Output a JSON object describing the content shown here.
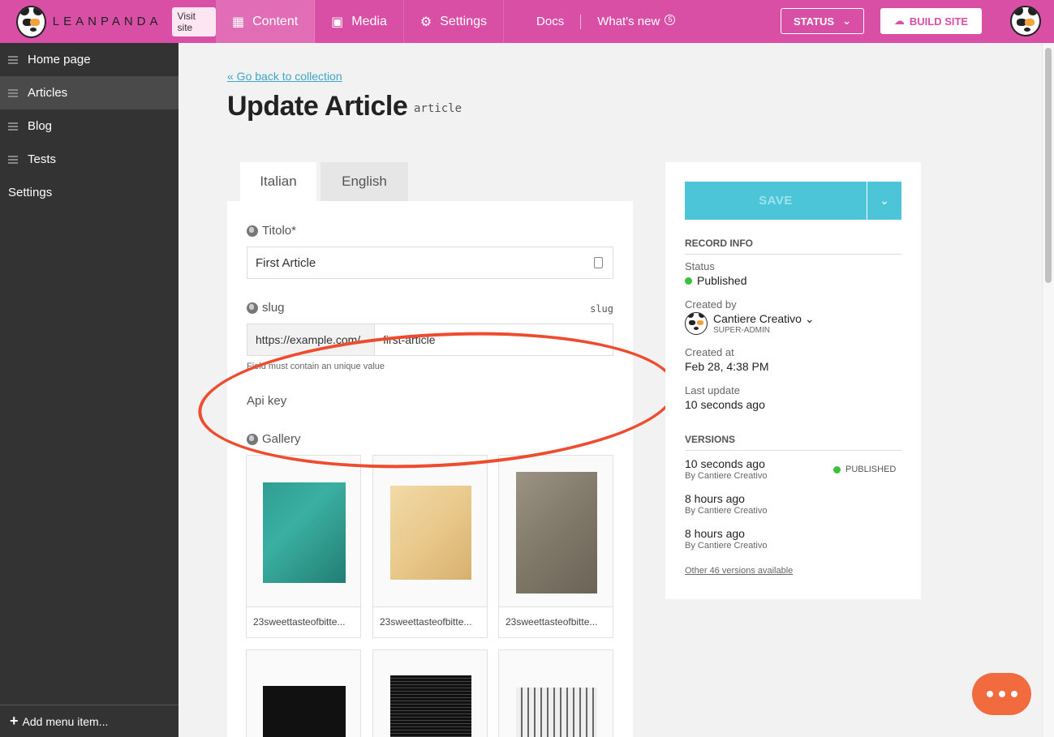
{
  "brand": {
    "wordmark": "LEANPANDA",
    "visit_label": "Visit site"
  },
  "nav": {
    "content": "Content",
    "media": "Media",
    "settings": "Settings",
    "docs": "Docs",
    "whats_new": "What's new",
    "whats_new_badge": "5",
    "status": "STATUS",
    "build": "BUILD SITE"
  },
  "sidebar": {
    "items": [
      {
        "label": "Home page"
      },
      {
        "label": "Articles"
      },
      {
        "label": "Blog"
      },
      {
        "label": "Tests"
      }
    ],
    "settings_label": "Settings",
    "add_label": "Add menu item..."
  },
  "page": {
    "back_link": "« Go back to collection",
    "title": "Update Article",
    "model": "article"
  },
  "tabs": [
    {
      "label": "Italian"
    },
    {
      "label": "English"
    }
  ],
  "form": {
    "titolo_label": "Titolo*",
    "titolo_value": "First Article",
    "slug_label": "slug",
    "slug_tag": "slug",
    "slug_prefix": "https://example.com/",
    "slug_value": "first-article",
    "slug_hint": "Field must contain an unique value",
    "apikey_label": "Api key",
    "gallery_label": "Gallery",
    "gallery": [
      {
        "caption": "23sweettasteofbitte..."
      },
      {
        "caption": "23sweettasteofbitte..."
      },
      {
        "caption": "23sweettasteofbitte..."
      }
    ]
  },
  "panel": {
    "save_label": "SAVE",
    "record_info": "RECORD INFO",
    "status_label": "Status",
    "status_value": "Published",
    "created_by_label": "Created by",
    "creator_name": "Cantiere Creativo",
    "creator_role": "SUPER-ADMIN",
    "created_at_label": "Created at",
    "created_at_value": "Feb 28, 4:38 PM",
    "last_update_label": "Last update",
    "last_update_value": "10 seconds ago",
    "versions_label": "VERSIONS",
    "versions": [
      {
        "time": "10 seconds ago",
        "by": "By Cantiere Creativo",
        "badge": "PUBLISHED"
      },
      {
        "time": "8 hours ago",
        "by": "By Cantiere Creativo"
      },
      {
        "time": "8 hours ago",
        "by": "By Cantiere Creativo"
      }
    ],
    "more_versions": "Other 46 versions available"
  },
  "colors": {
    "brand": "#d94fa6",
    "accent": "#4cc5d8",
    "link": "#3ea6c6",
    "published": "#3cc13b",
    "annotation": "#ee4c2f",
    "chat": "#f26b3e"
  }
}
